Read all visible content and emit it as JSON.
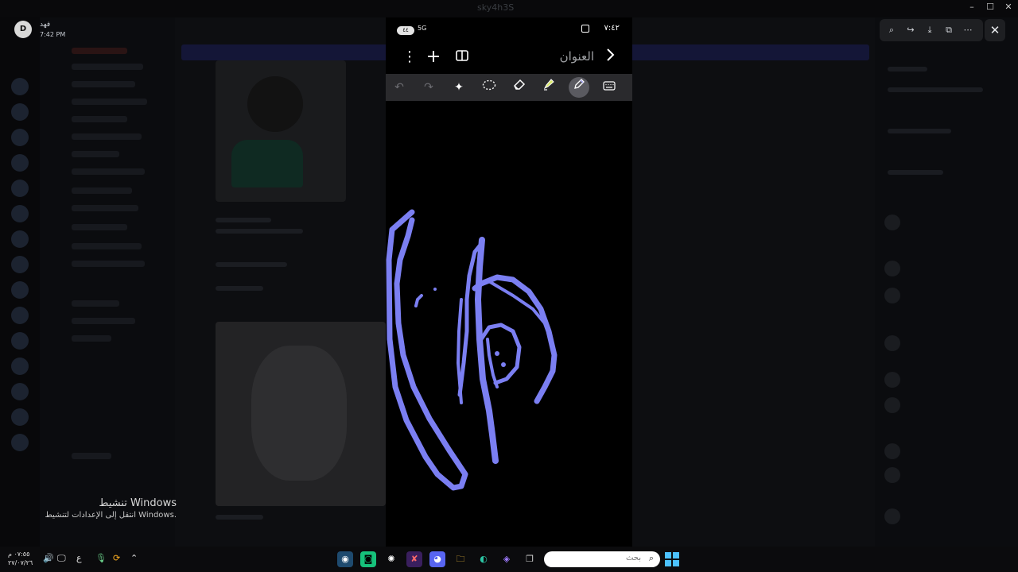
{
  "background_app": {
    "window_title": "sky4h3S",
    "user": {
      "avatar_letter": "D",
      "name": "فهد",
      "time": "7:42 PM"
    },
    "colors": {
      "banner": "#141637",
      "status_red": "#d12a2a"
    }
  },
  "viewer_toolbar": {
    "icons": [
      "zoom-in-icon",
      "share-icon",
      "download-icon",
      "open-external-icon",
      "more-icon"
    ],
    "close_icon": "✕"
  },
  "activation": {
    "title": "تنشيط Windows",
    "subtitle": "انتقل إلى الإعدادات لتنشيط Windows."
  },
  "phone": {
    "status": {
      "left_pill": "٤٤",
      "signal": "5G",
      "time": "٧:٤٢"
    },
    "title": "العنوان",
    "tools": [
      "undo",
      "redo",
      "ai-assist",
      "lasso",
      "eraser",
      "highlighter",
      "pen",
      "keyboard"
    ],
    "active_tool": "pen",
    "stroke_color": "#7b7ff2"
  },
  "taskbar": {
    "clock_time": "٠٧:٥٥ م",
    "clock_date": "٢٧/٠٧/٢٦",
    "lang": "ع",
    "search_placeholder": "بحث"
  }
}
